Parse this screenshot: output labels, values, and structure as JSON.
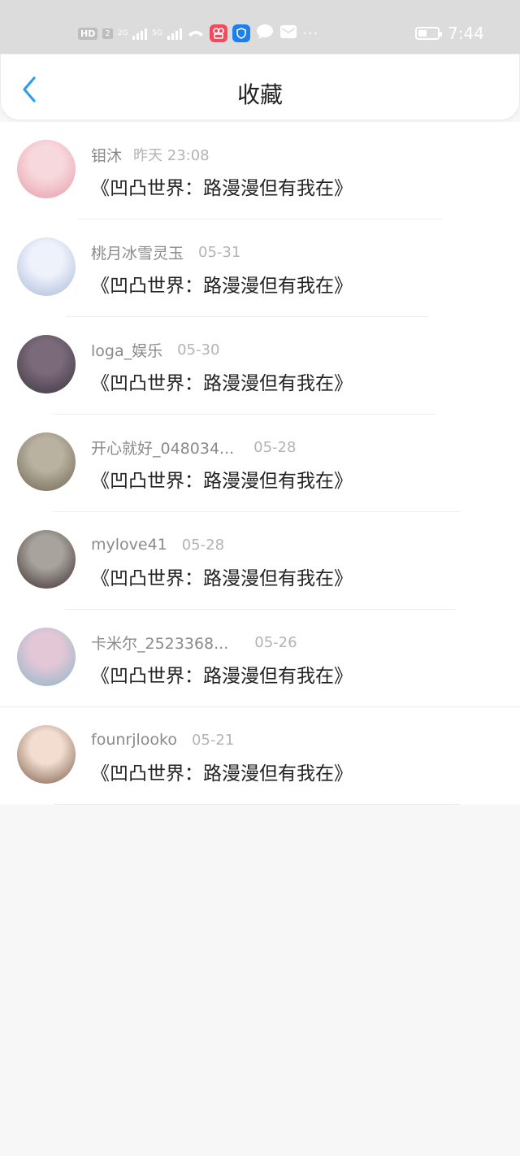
{
  "status_bar": {
    "hd": "HD",
    "sim": "2",
    "net1": "2G",
    "net2": "5G",
    "time": "7:44",
    "battery_level": 0.45,
    "icons": [
      "missed-call-icon",
      "app-icon",
      "shield-icon",
      "message-icon",
      "mail-icon",
      "more-icon"
    ]
  },
  "header": {
    "title": "收藏",
    "back_icon": "chevron-left-icon",
    "accent": "#2f9ee8"
  },
  "favorites": [
    {
      "name": "钼沐",
      "time": "昨天 23:08",
      "content": "《凹凸世界：路漫漫但有我在》",
      "avatar_colors": [
        "#f7d9dd",
        "#e79aa7"
      ]
    },
    {
      "name": "桃月冰雪灵玉",
      "time": "05-31",
      "content": "《凹凸世界：路漫漫但有我在》",
      "avatar_colors": [
        "#eef2fb",
        "#a9b8d8"
      ]
    },
    {
      "name": "loga_娱乐",
      "time": "05-30",
      "content": "《凹凸世界：路漫漫但有我在》",
      "avatar_colors": [
        "#7a6a7a",
        "#3d3440"
      ]
    },
    {
      "name": "开心就好_048034...",
      "time": "05-28",
      "content": "《凹凸世界：路漫漫但有我在》",
      "avatar_colors": [
        "#b9b2a0",
        "#6d6450"
      ]
    },
    {
      "name": "mylove41",
      "time": "05-28",
      "content": "《凹凸世界：路漫漫但有我在》",
      "avatar_colors": [
        "#a8a39d",
        "#3a2c2c"
      ]
    },
    {
      "name": "卡米尔_2523368...",
      "time": "05-26",
      "content": "《凹凸世界：路漫漫但有我在》",
      "avatar_colors": [
        "#e3c7d6",
        "#8ab6c9"
      ]
    },
    {
      "name": "founrjlooko",
      "time": "05-21",
      "content": "《凹凸世界：路漫漫但有我在》",
      "avatar_colors": [
        "#f2ddd0",
        "#7a5a45"
      ]
    }
  ]
}
